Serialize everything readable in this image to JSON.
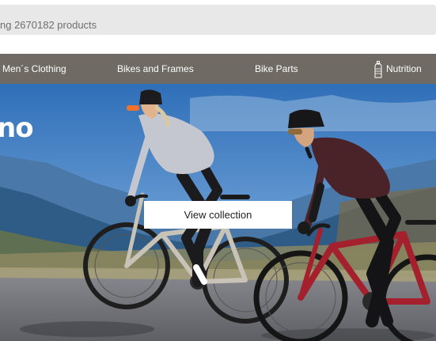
{
  "search": {
    "placeholder_text": "ng 2670182 products"
  },
  "nav": {
    "items": [
      {
        "label": "Men´s Clothing"
      },
      {
        "label": "Bikes and Frames"
      },
      {
        "label": "Bike Parts"
      },
      {
        "label": "Nutrition",
        "icon": "bottle-icon"
      }
    ]
  },
  "hero": {
    "brand_logo": "no",
    "cta_label": "View collection"
  },
  "colors": {
    "navbar": "#6f6b64",
    "search_bg": "#e8e8e8",
    "sky": "#3f7fc4",
    "road": "#7a7a7f",
    "bike_left": "#c9c2b6",
    "bike_right": "#a3202c"
  }
}
